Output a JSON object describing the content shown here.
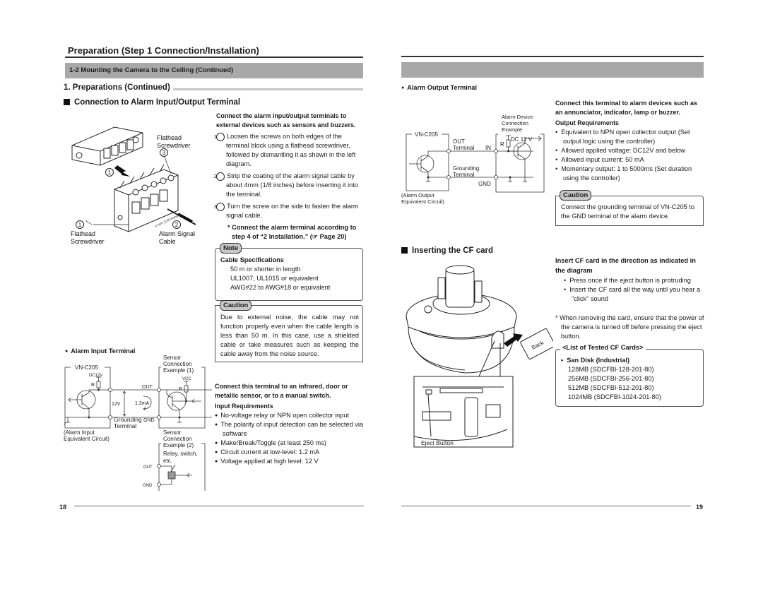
{
  "left_page": {
    "page_title": "Preparation (Step 1 Connection/Installation)",
    "section_bar": "1-2 Mounting the Camera to the Ceiling (Continued)",
    "subsection": "1.  Preparations (Continued)",
    "heading": "Connection to Alarm Input/Output Terminal",
    "terminal_figure": {
      "label_flathead_top": [
        "Flathead",
        "Screwdriver"
      ],
      "label_flathead_bottom": [
        "Flathead",
        "Screwdriver"
      ],
      "label_cable": [
        "Alarm Signal",
        "Cable"
      ],
      "callout_1": "1",
      "callout_2": "2",
      "callout_3": "3",
      "dimension_text": "4 mm (1/8 inches)"
    },
    "intro": "Connect the alarm input/output terminals to external devices such as sensors and buzzers.",
    "steps": [
      {
        "num": "1",
        "text": "Loosen the screws on both edges of the terminal block using a flathead screwdriver, followed by dismantling it as shown in the left diagram."
      },
      {
        "num": "2",
        "text": "Strip the coating of the alarm signal cable by about 4mm (1/8 inches) before inserting it into the terminal."
      },
      {
        "num": "3",
        "text": "Turn the screw on the side to fasten the alarm signal cable."
      }
    ],
    "step_note": "* Connect the alarm terminal according to step 4 of “2 Installation.” (☞ Page 20)",
    "note_box": {
      "label": "Note",
      "title": "Cable Specifications",
      "items": [
        "50 m or shorter in length",
        "UL1007, UL1015 or equivalent",
        "AWG#22 to AWG#18 or equivalent"
      ]
    },
    "caution_box": {
      "label": "Caution",
      "text": "Due to external noise, the cable may not function properly even when the cable length is less than 50 m. In this case, use a shielded cable or take measures such as keeping the cable away from the noise source."
    },
    "alarm_input": {
      "heading": "Alarm Input Terminal",
      "circuit": {
        "device": "VN-C205",
        "dc": "DC12V",
        "r": "R",
        "out": "OUT",
        "gnd": "GND",
        "voltage": "12V",
        "current": "1.2mA",
        "grounding": [
          "Grounding",
          "Terminal"
        ],
        "caption": [
          "(Alarm Input",
          "Equivalent Circuit)"
        ],
        "sensor1": [
          "Sensor",
          "Connection",
          "Example (1)"
        ],
        "vcc": "VCC",
        "sensor2": [
          "Sensor",
          "Connection",
          "Example (2)"
        ],
        "relay": [
          "Relay, switch,",
          "etc."
        ]
      },
      "intro": "Connect this terminal to an infrared, door or metallic sensor, or to a manual switch.",
      "req_title": "Input Requirements",
      "requirements": [
        "No-voltage relay or NPN open collector input",
        "The polarity of input detection can be selected via software",
        "Make/Break/Toggle (at least 250 ms)",
        "Circuit current at low-level: 1.2 mA",
        "Voltage applied at high level: 12 V"
      ]
    },
    "page_number": "18"
  },
  "right_page": {
    "alarm_output": {
      "heading": "Alarm Output Terminal",
      "circuit": {
        "device": "VN-C205",
        "out_terminal": [
          "OUT",
          "Terminal"
        ],
        "grounding": [
          "Grounding",
          "Terminal"
        ],
        "in": "IN",
        "gnd": "GND",
        "r": "R",
        "dc": "DC 12 V",
        "device_example": [
          "Alarm Device",
          "Connection",
          "Example"
        ],
        "caption": [
          "(Alarm Output",
          "Equivalent Circuit)"
        ]
      },
      "intro": "Connect this terminal to alarm devices such as an annunciator, indicator, lamp or buzzer.",
      "req_title": "Output Requirements",
      "requirements": [
        "Equivalent to NPN open collector output (Set output logic using the controller)",
        "Allowed applied voltage: DC12V and below",
        "Allowed input current: 50 mA",
        "Momentary output: 1 to 5000ms (Set duration using the controller)"
      ],
      "caution_box": {
        "label": "Caution",
        "text": "Connect the grounding terminal of VN-C205 to the GND terminal of the alarm device."
      }
    },
    "cf_card": {
      "heading": "Inserting the CF card",
      "figure": {
        "card_label": "Back",
        "eject_label": "Eject Button"
      },
      "instruction_title": "Insert CF card in the direction as indicated in the diagram",
      "bullets": [
        "Press once if the eject button is protruding",
        "Insert the CF card all the way until you hear a \"click\" sound"
      ],
      "removal_note": "* When removing the card, ensure that the power of the camera is turned off before pressing the eject button.",
      "tested_list": {
        "label": "<List of Tested CF Cards>",
        "brand": "San Disk (Industrial)",
        "cards": [
          "128MB (SDCFBI-128-201-80)",
          "256MB (SDCFBI-256-201-80)",
          "512MB (SDCFBI-512-201-80)",
          "1024MB (SDCFBI-1024-201-80)"
        ]
      }
    },
    "page_number": "19"
  }
}
